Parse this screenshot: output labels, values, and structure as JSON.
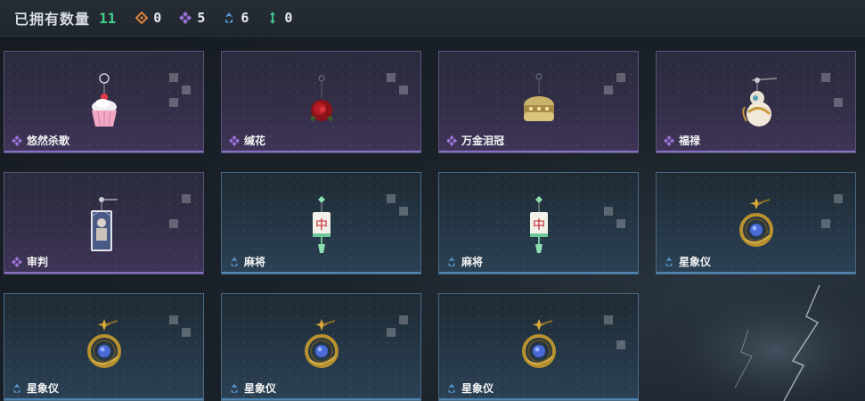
{
  "header": {
    "title": "已拥有数量",
    "total": "11",
    "stats": [
      {
        "icon": "orange-diamond-icon",
        "color": "#d9823a",
        "value": "0"
      },
      {
        "icon": "purple-diamond-icon",
        "color": "#9a72d6",
        "value": "5"
      },
      {
        "icon": "blue-chevron-icon",
        "color": "#5a9bd6",
        "value": "6"
      },
      {
        "icon": "green-arrows-icon",
        "color": "#3fbf8a",
        "value": "0"
      }
    ]
  },
  "items": [
    {
      "name": "悠然杀歌",
      "rarity": "purple",
      "art": "cupcake-charm"
    },
    {
      "name": "缄花",
      "rarity": "purple",
      "art": "rose-charm"
    },
    {
      "name": "万金泪冠",
      "rarity": "purple",
      "art": "golden-crown-charm"
    },
    {
      "name": "福禄",
      "rarity": "purple",
      "art": "gourd-charm"
    },
    {
      "name": "审判",
      "rarity": "purple",
      "art": "tarot-card-charm"
    },
    {
      "name": "麻将",
      "rarity": "blue",
      "art": "mahjong-charm"
    },
    {
      "name": "麻将",
      "rarity": "blue",
      "art": "mahjong-charm"
    },
    {
      "name": "星象仪",
      "rarity": "blue",
      "art": "astrolabe-charm"
    },
    {
      "name": "星象仪",
      "rarity": "blue",
      "art": "astrolabe-charm"
    },
    {
      "name": "星象仪",
      "rarity": "blue",
      "art": "astrolabe-charm"
    },
    {
      "name": "星象仪",
      "rarity": "blue",
      "art": "astrolabe-charm"
    }
  ]
}
